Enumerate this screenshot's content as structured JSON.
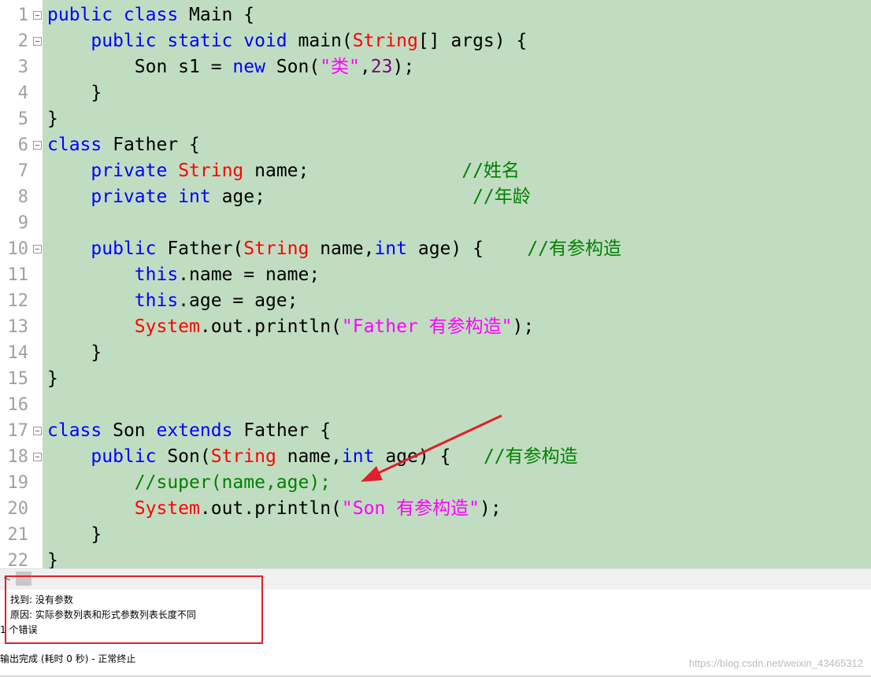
{
  "editor": {
    "line_numbers": [
      "1",
      "2",
      "3",
      "4",
      "5",
      "6",
      "7",
      "8",
      "9",
      "10",
      "11",
      "12",
      "13",
      "14",
      "15",
      "16",
      "17",
      "18",
      "19",
      "20",
      "21",
      "22"
    ],
    "lines": [
      [
        {
          "t": "public class",
          "c": "kw"
        },
        {
          "t": " Main {"
        }
      ],
      [
        {
          "t": "    "
        },
        {
          "t": "public static void",
          "c": "kw"
        },
        {
          "t": " main("
        },
        {
          "t": "String",
          "c": "ty"
        },
        {
          "t": "[] args) {"
        }
      ],
      [
        {
          "t": "        Son s1 = "
        },
        {
          "t": "new",
          "c": "kw"
        },
        {
          "t": " Son("
        },
        {
          "t": "\"类\"",
          "c": "st"
        },
        {
          "t": ","
        },
        {
          "t": "23",
          "c": "nm"
        },
        {
          "t": ");"
        }
      ],
      [
        {
          "t": "    }"
        }
      ],
      [
        {
          "t": "}"
        }
      ],
      [
        {
          "t": "class",
          "c": "kw"
        },
        {
          "t": " Father {"
        }
      ],
      [
        {
          "t": "    "
        },
        {
          "t": "private",
          "c": "kw"
        },
        {
          "t": " "
        },
        {
          "t": "String",
          "c": "ty"
        },
        {
          "t": " name;              "
        },
        {
          "t": "//姓名",
          "c": "cm"
        }
      ],
      [
        {
          "t": "    "
        },
        {
          "t": "private int",
          "c": "kw"
        },
        {
          "t": " age;                   "
        },
        {
          "t": "//年龄",
          "c": "cm"
        }
      ],
      [],
      [
        {
          "t": "    "
        },
        {
          "t": "public",
          "c": "kw"
        },
        {
          "t": " Father("
        },
        {
          "t": "String",
          "c": "ty"
        },
        {
          "t": " name,"
        },
        {
          "t": "int",
          "c": "kw"
        },
        {
          "t": " age) {    "
        },
        {
          "t": "//有参构造",
          "c": "cm"
        }
      ],
      [
        {
          "t": "        "
        },
        {
          "t": "this",
          "c": "kw"
        },
        {
          "t": ".name = name;"
        }
      ],
      [
        {
          "t": "        "
        },
        {
          "t": "this",
          "c": "kw"
        },
        {
          "t": ".age = age;"
        }
      ],
      [
        {
          "t": "        "
        },
        {
          "t": "System",
          "c": "ty"
        },
        {
          "t": ".out.println("
        },
        {
          "t": "\"Father 有参构造\"",
          "c": "st"
        },
        {
          "t": ");"
        }
      ],
      [
        {
          "t": "    }"
        }
      ],
      [
        {
          "t": "}"
        }
      ],
      [],
      [
        {
          "t": "class",
          "c": "kw"
        },
        {
          "t": " Son "
        },
        {
          "t": "extends",
          "c": "kw"
        },
        {
          "t": " Father {"
        }
      ],
      [
        {
          "t": "    "
        },
        {
          "t": "public",
          "c": "kw"
        },
        {
          "t": " Son("
        },
        {
          "t": "String",
          "c": "ty"
        },
        {
          "t": " name,"
        },
        {
          "t": "int",
          "c": "kw"
        },
        {
          "t": " age) {   "
        },
        {
          "t": "//有参构造",
          "c": "cm"
        }
      ],
      [
        {
          "t": "        "
        },
        {
          "t": "//super(name,age);",
          "c": "cm"
        }
      ],
      [
        {
          "t": "        "
        },
        {
          "t": "System",
          "c": "ty"
        },
        {
          "t": ".out.println("
        },
        {
          "t": "\"Son 有参构造\"",
          "c": "st"
        },
        {
          "t": ");"
        }
      ],
      [
        {
          "t": "    }"
        }
      ],
      [
        {
          "t": "}"
        }
      ]
    ],
    "fold_lines": [
      1,
      2,
      6,
      10,
      17,
      18
    ]
  },
  "colors": {
    "code_background": "#c1ddc1",
    "keyword": "#0000ff",
    "type": "#ff0000",
    "string": "#ff00ff",
    "number": "#800080",
    "comment": "#008000",
    "annotation": "#e0202a"
  },
  "scrollbar": {
    "left_arrow": "<"
  },
  "output": {
    "found_line": "找到: 没有参数",
    "reason_line": "原因: 实际参数列表和形式参数列表长度不同",
    "error_count_line": "1 个错误",
    "complete_line": "输出完成 (耗时 0 秒) - 正常终止"
  },
  "watermark": "https://blog.csdn.net/weixin_43465312"
}
